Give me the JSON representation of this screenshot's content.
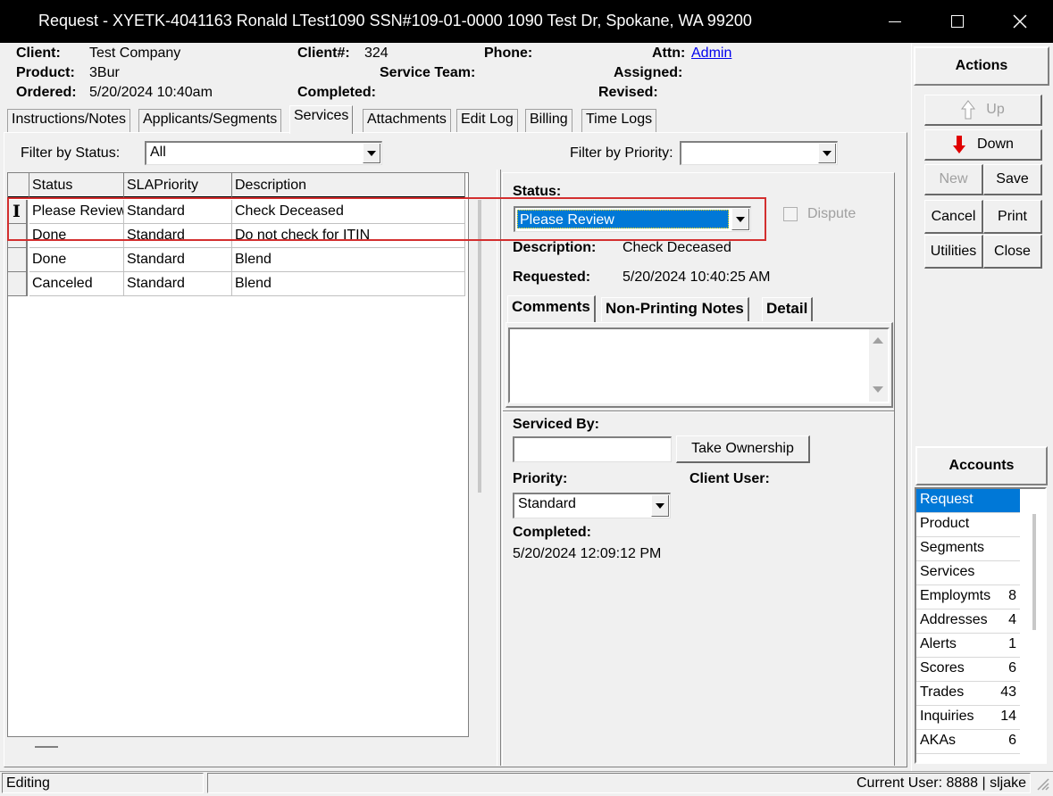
{
  "window": {
    "title": "Request - XYETK-4041163  Ronald LTest1090  SSN#109-01-0000  1090 Test Dr, Spokane, WA 99200"
  },
  "header": {
    "client_label": "Client:",
    "client_value": "Test Company",
    "clientnum_label": "Client#:",
    "clientnum_value": "324",
    "phone_label": "Phone:",
    "attn_label": "Attn:",
    "attn_value": "Admin",
    "product_label": "Product:",
    "product_value": "3Bur",
    "service_team_label": "Service Team:",
    "assigned_label": "Assigned:",
    "ordered_label": "Ordered:",
    "ordered_value": "5/20/2024 10:40am",
    "completed_label": "Completed:",
    "revised_label": "Revised:"
  },
  "tabs": [
    {
      "label": "Instructions/Notes"
    },
    {
      "label": "Applicants/Segments"
    },
    {
      "label": "Services"
    },
    {
      "label": "Attachments"
    },
    {
      "label": "Edit Log"
    },
    {
      "label": "Billing"
    },
    {
      "label": "Time Logs"
    }
  ],
  "filters": {
    "status_label": "Filter by Status:",
    "status_value": "All",
    "priority_label": "Filter by Priority:",
    "priority_value": ""
  },
  "grid": {
    "columns": [
      "Status",
      "SLAPriority",
      "Description"
    ],
    "rows": [
      {
        "status": "Please Review",
        "priority": "Standard",
        "description": "Check Deceased"
      },
      {
        "status": "Done",
        "priority": "Standard",
        "description": "Do not check for ITIN"
      },
      {
        "status": "Done",
        "priority": "Standard",
        "description": "Blend"
      },
      {
        "status": "Canceled",
        "priority": "Standard",
        "description": "Blend"
      }
    ]
  },
  "detail": {
    "status_label": "Status:",
    "status_value": "Please Review",
    "dispute_label": "Dispute",
    "description_label": "Description:",
    "description_value": "Check Deceased",
    "requested_label": "Requested:",
    "requested_value": "5/20/2024 10:40:25 AM",
    "inner_tabs": [
      {
        "label": "Comments"
      },
      {
        "label": "Non-Printing Notes"
      },
      {
        "label": "Detail"
      }
    ],
    "serviced_by_label": "Serviced By:",
    "serviced_by_value": "",
    "take_ownership_label": "Take Ownership",
    "priority_label": "Priority:",
    "priority_value": "Standard",
    "client_user_label": "Client User:",
    "completed_label": "Completed:",
    "completed_value": "5/20/2024 12:09:12 PM"
  },
  "actions": {
    "header": "Actions",
    "up": "Up",
    "down": "Down",
    "new": "New",
    "save": "Save",
    "cancel": "Cancel",
    "print": "Print",
    "utilities": "Utilities",
    "close": "Close"
  },
  "accounts": {
    "header": "Accounts",
    "items": [
      {
        "label": "Request",
        "count": ""
      },
      {
        "label": "Product",
        "count": ""
      },
      {
        "label": "Segments",
        "count": ""
      },
      {
        "label": "Services",
        "count": ""
      },
      {
        "label": "Employmts",
        "count": "8"
      },
      {
        "label": "Addresses",
        "count": "4"
      },
      {
        "label": "Alerts",
        "count": "1"
      },
      {
        "label": "Scores",
        "count": "6"
      },
      {
        "label": "Trades",
        "count": "43"
      },
      {
        "label": "Inquiries",
        "count": "14"
      },
      {
        "label": "AKAs",
        "count": "6"
      }
    ]
  },
  "statusbar": {
    "mode": "Editing",
    "user": "Current User: 8888 | sljake"
  },
  "colors": {
    "selection": "#0078d7",
    "highlight_box": "#d32f2f",
    "down_arrow": "#e00000"
  },
  "icons": [
    "minimize-icon",
    "maximize-icon",
    "close-icon",
    "up-arrow-icon",
    "down-arrow-icon",
    "dropdown-arrow-icon",
    "text-cursor-icon"
  ]
}
